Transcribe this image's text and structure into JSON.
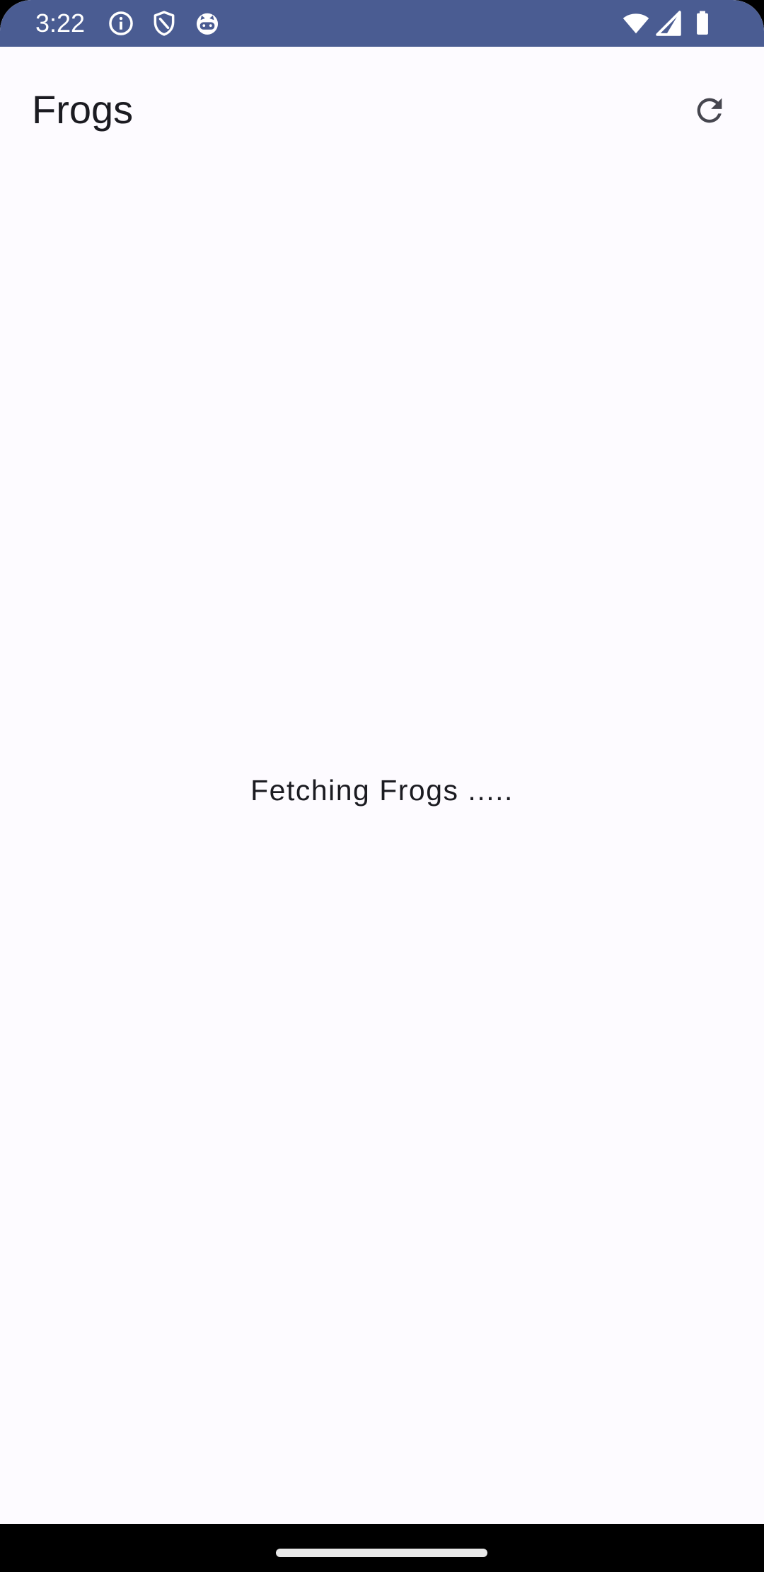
{
  "status_bar": {
    "time": "3:22",
    "background_color": "#4a5c92",
    "left_icons": [
      "info-icon",
      "shield-icon",
      "cat-face-icon"
    ],
    "right_icons": [
      "wifi-icon",
      "cellular-signal-icon",
      "battery-icon"
    ]
  },
  "app_bar": {
    "title": "Frogs",
    "action_icon": "refresh-icon"
  },
  "content": {
    "loading_text": "Fetching Frogs ....."
  },
  "nav_bar": {
    "handle": "home-handle"
  }
}
